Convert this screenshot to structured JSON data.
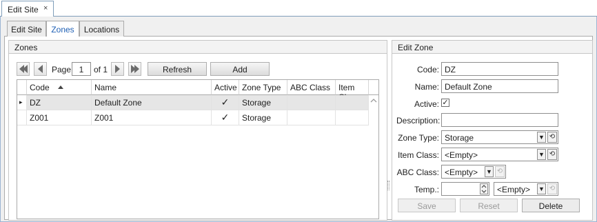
{
  "doc_tab": {
    "title": "Edit Site",
    "close": "×"
  },
  "tabs": [
    "Edit Site",
    "Zones",
    "Locations"
  ],
  "zones_panel": {
    "title": "Zones",
    "pager": {
      "page_label": "Page",
      "page_value": "1",
      "of_label": "of 1"
    },
    "refresh_label": "Refresh",
    "add_label": "Add",
    "columns": [
      "Code",
      "Name",
      "Active",
      "Zone Type",
      "ABC Class",
      "Item Class"
    ],
    "rows": [
      {
        "indicator": "▸",
        "code": "DZ",
        "name": "Default Zone",
        "active": "✓",
        "zone_type": "Storage",
        "abc": "",
        "item": ""
      },
      {
        "indicator": "",
        "code": "Z001",
        "name": "Z001",
        "active": "✓",
        "zone_type": "Storage",
        "abc": "",
        "item": ""
      }
    ]
  },
  "edit_panel": {
    "title": "Edit Zone",
    "code_label": "Code:",
    "code_value": "DZ",
    "name_label": "Name:",
    "name_value": "Default Zone",
    "active_label": "Active:",
    "active_mark": "✓",
    "description_label": "Description:",
    "description_value": "",
    "zone_type_label": "Zone Type:",
    "zone_type_value": "Storage",
    "item_class_label": "Item Class:",
    "item_class_value": "<Empty>",
    "abc_class_label": "ABC Class:",
    "abc_class_value": "<Empty>",
    "temp_label": "Temp.:",
    "temp_value": "",
    "temp_unit_value": "<Empty>",
    "save_label": "Save",
    "reset_label": "Reset",
    "delete_label": "Delete"
  }
}
